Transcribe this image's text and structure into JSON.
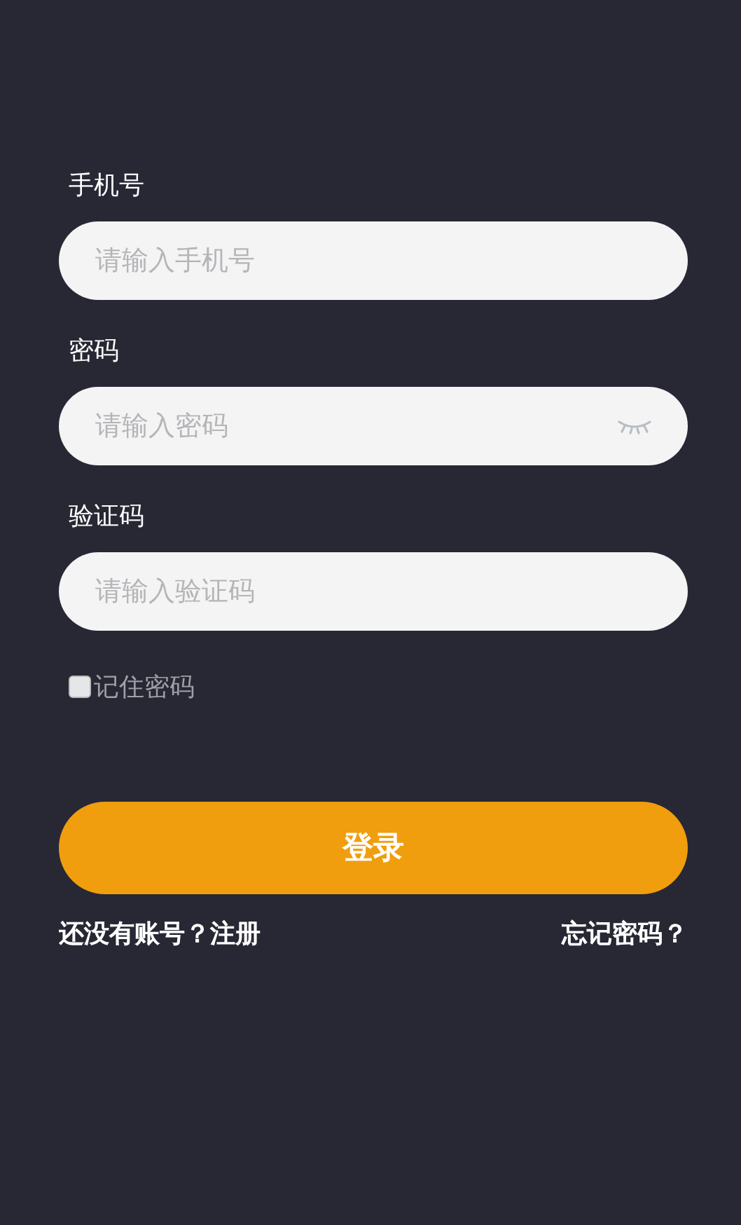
{
  "fields": [
    {
      "label": "手机号",
      "placeholder": "请输入手机号",
      "kind": "text"
    },
    {
      "label": "密码",
      "placeholder": "请输入密码",
      "kind": "password"
    },
    {
      "label": "验证码",
      "placeholder": "请输入验证码",
      "kind": "text"
    }
  ],
  "remember": {
    "label": "记住密码",
    "checked": false
  },
  "login_button": "登录",
  "links": {
    "register": "还没有账号？注册",
    "forgot": "忘记密码？"
  }
}
